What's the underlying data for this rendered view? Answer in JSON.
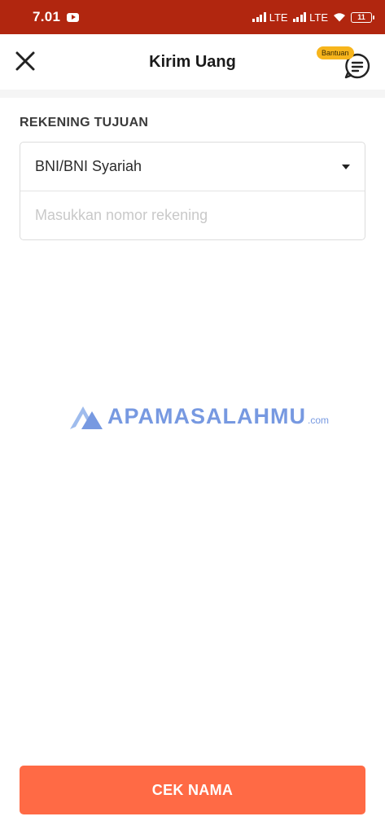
{
  "status_bar": {
    "time": "7.01",
    "network_1": "LTE",
    "network_2": "LTE",
    "battery": "11",
    "icons": [
      "youtube-icon",
      "signal-icon",
      "wifi-icon",
      "battery-icon"
    ]
  },
  "header": {
    "title": "Kirim Uang",
    "close_icon": "close-icon",
    "help_badge": "Bantuan",
    "help_icon": "chat-icon"
  },
  "form": {
    "section_label": "REKENING TUJUAN",
    "bank_value": "BNI/BNI Syariah",
    "account_placeholder": "Masukkan nomor rekening",
    "account_value": ""
  },
  "watermark": {
    "text": "APAMASALAHMU",
    "suffix": ".com"
  },
  "cta": {
    "label": "CEK NAMA"
  },
  "colors": {
    "status_bar": "#b1260f",
    "accent": "#ff6a45",
    "badge": "#f7b51c",
    "watermark": "#4a78d8"
  }
}
